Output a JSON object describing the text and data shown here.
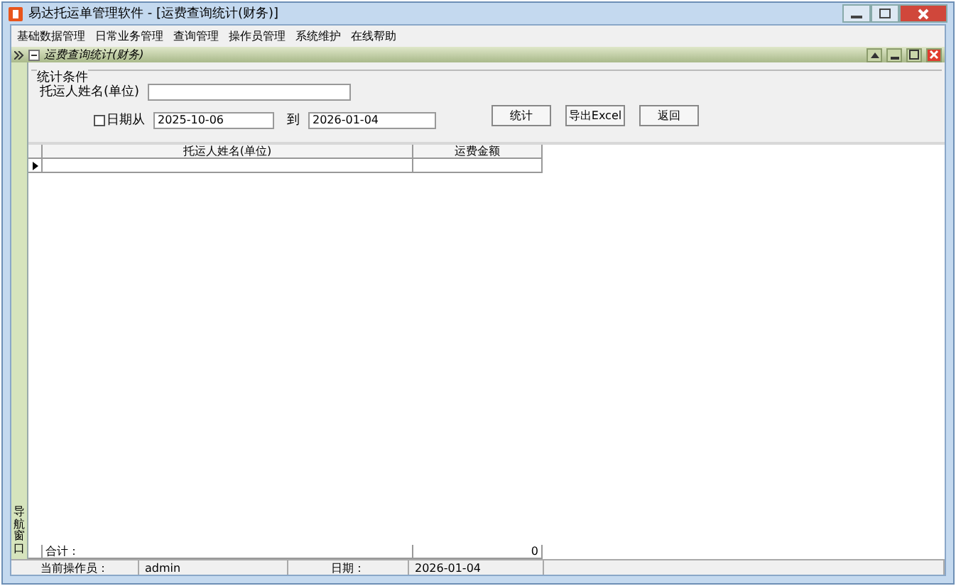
{
  "window": {
    "title": "易达托运单管理软件 - [运费查询统计(财务)]"
  },
  "menu": [
    "基础数据管理",
    "日常业务管理",
    "查询管理",
    "操作员管理",
    "系统维护",
    "在线帮助"
  ],
  "child_window": {
    "title": "运费查询统计(财务)"
  },
  "side_tab": {
    "label": "导航窗口"
  },
  "filter": {
    "legend": "统计条件",
    "shipper_label": "托运人姓名(单位)",
    "date_checkbox": {
      "label": "日期从",
      "checked": false
    },
    "date_from": "2025-10-06",
    "to_label": "到",
    "date_to": "2026-01-04",
    "buttons": [
      "统计",
      "导出Excel",
      "返回"
    ]
  },
  "table": {
    "columns": [
      "托运人姓名(单位)",
      "运费金额"
    ],
    "footer": {
      "label": "合计：",
      "total": "0"
    }
  },
  "status_bar": [
    {
      "label": "当前操作员：",
      "value": "admin"
    },
    {
      "label": "日期：",
      "value": "2026-01-04"
    }
  ]
}
